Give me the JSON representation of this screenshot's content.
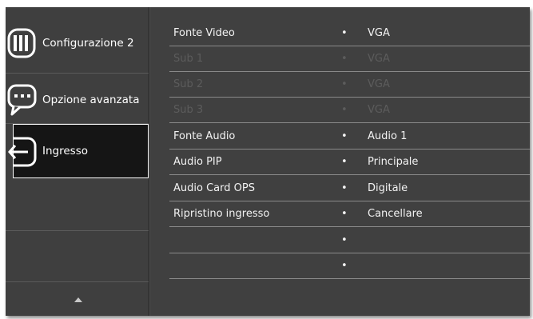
{
  "sidebar": {
    "items": [
      {
        "label": "Configurazione 2",
        "icon": "display-settings-icon",
        "selected": false
      },
      {
        "label": "Opzione avanzata",
        "icon": "chat-dots-icon",
        "selected": false
      },
      {
        "label": "Ingresso",
        "icon": "input-arrow-icon",
        "selected": true
      }
    ],
    "scroll_icon": "scroll-up-arrow-icon"
  },
  "menu": {
    "rows": [
      {
        "name": "Fonte Video",
        "bullet": "•",
        "value": "VGA",
        "enabled": true
      },
      {
        "name": "Sub 1",
        "bullet": "•",
        "value": "VGA",
        "enabled": false
      },
      {
        "name": "Sub 2",
        "bullet": "•",
        "value": "VGA",
        "enabled": false
      },
      {
        "name": "Sub 3",
        "bullet": "•",
        "value": "VGA",
        "enabled": false
      },
      {
        "name": "Fonte Audio",
        "bullet": "•",
        "value": "Audio 1",
        "enabled": true
      },
      {
        "name": "Audio PIP",
        "bullet": "•",
        "value": "Principale",
        "enabled": true
      },
      {
        "name": "Audio Card OPS",
        "bullet": "•",
        "value": "Digitale",
        "enabled": true
      },
      {
        "name": "Ripristino ingresso",
        "bullet": "•",
        "value": "Cancellare",
        "enabled": true
      },
      {
        "name": "",
        "bullet": "•",
        "value": "",
        "enabled": true
      },
      {
        "name": "",
        "bullet": "•",
        "value": "",
        "enabled": true
      }
    ]
  },
  "colors": {
    "panel_bg": "#404040",
    "selected_bg": "#151515",
    "text": "#f2f2f2",
    "disabled_text": "#5c5c5c"
  }
}
